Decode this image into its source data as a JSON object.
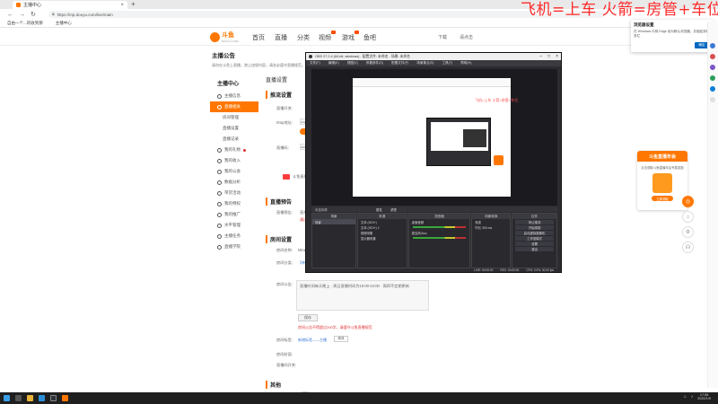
{
  "browser": {
    "tab_title": "主播中心",
    "url": "https://mp.douyu.com/live/main",
    "favorites": [
      "自由一个...的收到那",
      "主播中心"
    ]
  },
  "overlay_text": "飞机=上车 火箭=房管+车位",
  "site": {
    "logo_text": "斗鱼",
    "logo_sub": "DOUYU.COM",
    "nav": [
      "首页",
      "直播",
      "分类",
      "视频",
      "游戏",
      "鱼吧"
    ],
    "right": [
      "下载",
      "请点击"
    ],
    "notice_title": "主播公告",
    "notice_desc": "请勿在斗鱼上直播，禁止违规内容，请务必遵守直播规范，违者将被处罚。"
  },
  "sidebar": {
    "heading": "主播中心",
    "items": [
      {
        "label": "主播信息",
        "sub": false,
        "active": false
      },
      {
        "label": "直播相关",
        "sub": false,
        "active": true
      },
      {
        "label": "房间管理",
        "sub": true,
        "active": false
      },
      {
        "label": "直播设置",
        "sub": true,
        "active": false
      },
      {
        "label": "直播记录",
        "sub": true,
        "active": false
      },
      {
        "label": "我的礼物",
        "sub": false,
        "active": false
      },
      {
        "label": "我的收入",
        "sub": false,
        "active": false
      },
      {
        "label": "我的公会",
        "sub": false,
        "active": false
      },
      {
        "label": "数据分析",
        "sub": false,
        "active": false
      },
      {
        "label": "带货活动",
        "sub": false,
        "active": false
      },
      {
        "label": "我的特权",
        "sub": false,
        "active": false
      },
      {
        "label": "我的推广",
        "sub": false,
        "active": false
      },
      {
        "label": "水平管理",
        "sub": false,
        "active": false
      },
      {
        "label": "主播任务",
        "sub": false,
        "active": false
      },
      {
        "label": "直播学院",
        "sub": false,
        "active": false
      }
    ]
  },
  "main": {
    "page_title": "直播设置",
    "s1": "推流设置",
    "live_switch": "直播开关:",
    "rtmp_label": "rtmp地址:",
    "rtmp_value": "rtmp://sendtc3.douyu.com/live",
    "key_label": "直播码:",
    "key_value": "3425454rWnqR...",
    "tip_label": "斗鱼直播伴侣",
    "s2": "直播预告",
    "s2_label": "直播预告:",
    "s2_value": "直播预告内容",
    "s2_red": "通过审核才会展示",
    "s3": "房间设置",
    "room_name_label": "房间名称:",
    "room_name_value": "Miracle",
    "room_cat_label": "房间分类:",
    "room_cat_value": "【单机】游戏",
    "room_notice_label": "房间公告:",
    "room_notice_value": "直播时间每天晚上 · 周日直播时间为19:00-24:00 · 周四不定期更新",
    "save_btn": "保存",
    "room_red": "房间公告不得超过200字，请遵守斗鱼直播规范",
    "tag_label": "房间标签:",
    "tag_value": "新增标签——主播",
    "tag_btn": "修改",
    "s3_label3": "房间封面:",
    "s3_label4": "直播间开关:",
    "s4": "其他"
  },
  "obs": {
    "title": "OBS 27.2.4 (64-bit, windows) - 配置文件: 未命名 - 场景: 未命名",
    "menu": [
      "文件(F)",
      "编辑(E)",
      "视图(V)",
      "停靠部件(D)",
      "配置文件(P)",
      "场景集合(S)",
      "工具(T)",
      "帮助(H)"
    ],
    "mini_overlay": "飞机=上车 火箭=房管+车位",
    "ctrl_label": "未选择源",
    "ctrl_buttons": [
      "属性",
      "滤镜"
    ],
    "docks": {
      "scenes": {
        "title": "场景",
        "items": [
          "场景"
        ]
      },
      "sources": {
        "title": "来源",
        "items": [
          "文本 (GDI+)",
          "文本 (GDI+) 2",
          "视频采集",
          "显示器采集"
        ]
      },
      "mixer": {
        "title": "混音器",
        "items": [
          "桌面音频",
          "麦克风/Aux"
        ]
      },
      "transitions": {
        "title": "场景转换",
        "items": [
          "渐变",
          "时长 300 ms"
        ]
      },
      "controls": {
        "title": "控件",
        "items": [
          "停止推流",
          "开始录制",
          "启动虚拟摄像机",
          "工作室模式",
          "设置",
          "退出"
        ]
      }
    },
    "status": [
      "LIVE: 00:00:00",
      "REC: 00:00:00",
      "CPU: 2.0%, 30.00 fps"
    ]
  },
  "edge_popup": {
    "title": "浏览器设置",
    "desc": "在 Windows 中将 Edge 设为默认浏览器，并固定到任务栏",
    "button": "确定"
  },
  "promo": {
    "title": "斗鱼直播年会",
    "desc": "点击领取斗鱼直播年会专属奖励",
    "button": "立即领取"
  },
  "taskbar": {
    "time": "17:58",
    "date": "2022/1/9"
  },
  "colors": {
    "brand": "#ff7700",
    "alert": "#e03030",
    "overlay": "#ff2a2a"
  }
}
